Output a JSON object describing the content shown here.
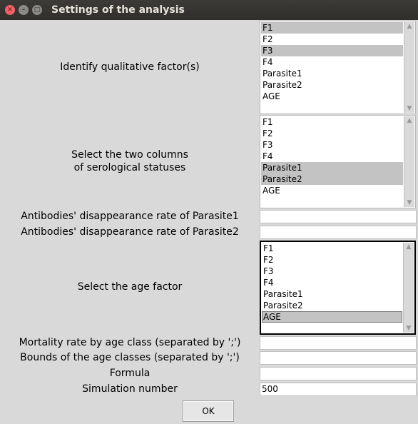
{
  "window": {
    "title": "Settings of the analysis"
  },
  "labels": {
    "qualitative": "Identify qualitative factor(s)",
    "serological_1": "Select the two columns",
    "serological_2": "of serological statuses",
    "rate1": "Antibodies' disappearance rate of Parasite1",
    "rate2": "Antibodies' disappearance rate of Parasite2",
    "age_factor": "Select the age factor",
    "mortality": "Mortality rate by age class (separated by ';')",
    "bounds": "Bounds of the age classes (separated by ';')",
    "formula": "Formula",
    "simulation": "Simulation number"
  },
  "lists": {
    "qualitative": {
      "items": [
        "F1",
        "F2",
        "F3",
        "F4",
        "Parasite1",
        "Parasite2",
        "AGE"
      ],
      "selected": [
        "F1",
        "F3"
      ]
    },
    "serological": {
      "items": [
        "F1",
        "F2",
        "F3",
        "F4",
        "Parasite1",
        "Parasite2",
        "AGE"
      ],
      "selected": [
        "Parasite1",
        "Parasite2"
      ]
    },
    "age": {
      "items": [
        "F1",
        "F2",
        "F3",
        "F4",
        "Parasite1",
        "Parasite2",
        "AGE"
      ],
      "selected": [
        "AGE"
      ]
    }
  },
  "fields": {
    "rate1": "",
    "rate2": "",
    "mortality": "",
    "bounds": "",
    "formula": "",
    "simulation": "500"
  },
  "buttons": {
    "ok": "OK"
  },
  "icons": {
    "close": "close-icon",
    "minimize": "minimize-icon",
    "maximize": "maximize-icon",
    "scroll_up": "scroll-up-arrow-icon",
    "scroll_down": "scroll-down-arrow-icon"
  }
}
